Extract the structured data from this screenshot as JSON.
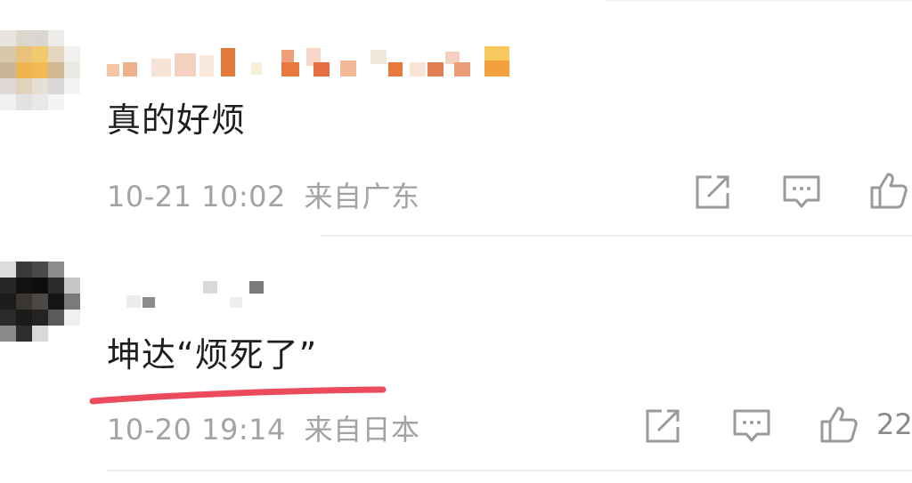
{
  "colors": {
    "text": "#1e1e1e",
    "meta": "#a3a3a3",
    "icon": "#9a9a9a",
    "divider": "#eeeeee",
    "annotation_underline": "#ec4b5e"
  },
  "comments": [
    {
      "text": "真的好烦",
      "time": "10-21 10:02",
      "location": "来自广东",
      "like_count": "",
      "actions": [
        "share-icon",
        "comment-icon",
        "like-icon"
      ]
    },
    {
      "text": "坤达“烦死了”",
      "time": "10-20 19:14",
      "location": "来自日本",
      "like_count": "22",
      "actions": [
        "share-icon",
        "comment-icon",
        "like-icon"
      ]
    }
  ]
}
